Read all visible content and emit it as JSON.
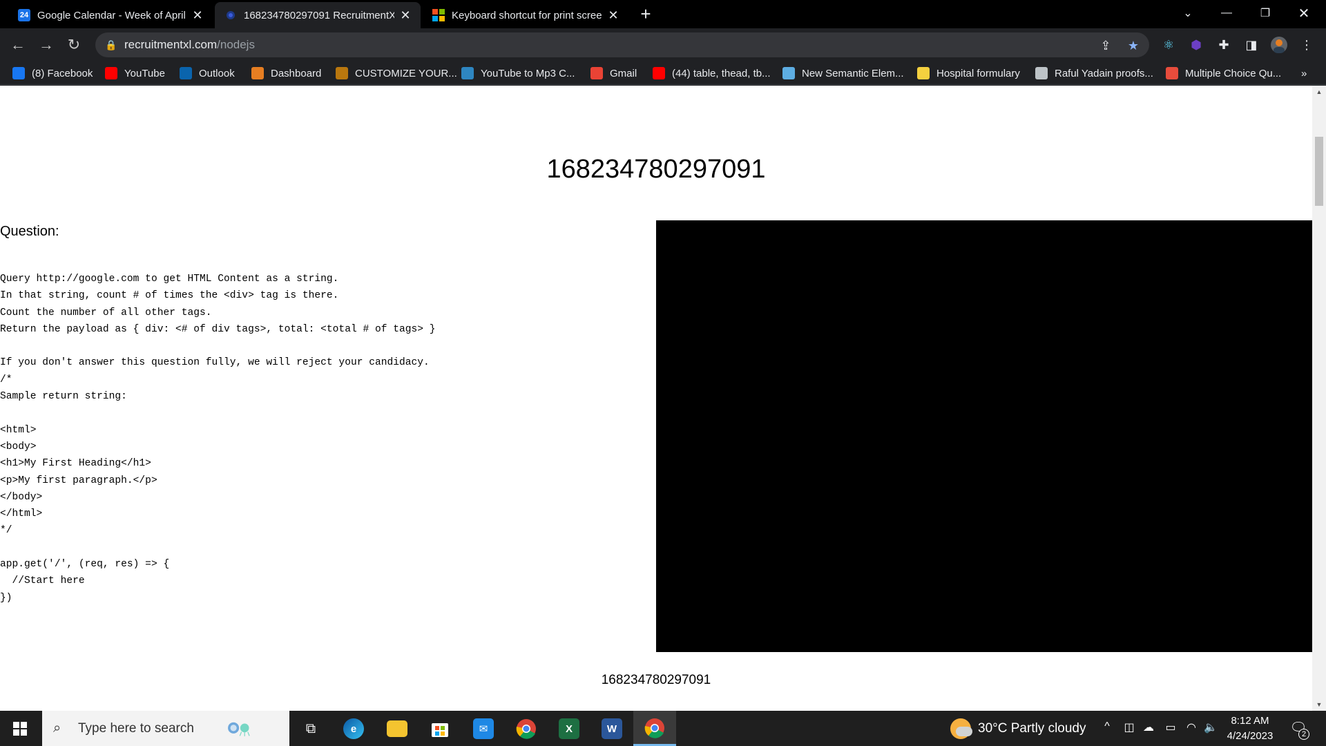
{
  "tabs": [
    {
      "title": "Google Calendar - Week of April",
      "favicon": "24",
      "active": false
    },
    {
      "title": "168234780297091 RecruitmentXL",
      "favicon": "",
      "active": true
    },
    {
      "title": "Keyboard shortcut for print scree",
      "favicon": "",
      "active": false
    }
  ],
  "address": {
    "host": "recruitmentxl.com",
    "path": "/nodejs"
  },
  "bookmarks": [
    {
      "label": "(8) Facebook",
      "icon": "facebook-icon",
      "color": "#1877f2"
    },
    {
      "label": "YouTube",
      "icon": "youtube-icon",
      "color": "#ff0000"
    },
    {
      "label": "Outlook",
      "icon": "outlook-icon",
      "color": "#0a64ad"
    },
    {
      "label": "Dashboard",
      "icon": "dashboard-icon",
      "color": "#e67e22"
    },
    {
      "label": "CUSTOMIZE YOUR...",
      "icon": "customize-icon",
      "color": "#b9770e"
    },
    {
      "label": "YouTube to Mp3 C...",
      "icon": "download-icon",
      "color": "#2e86c1"
    },
    {
      "label": "Gmail",
      "icon": "gmail-icon",
      "color": "#ea4335"
    },
    {
      "label": "(44) table, thead, tb...",
      "icon": "youtube-icon",
      "color": "#ff0000"
    },
    {
      "label": "New Semantic Elem...",
      "icon": "semantic-icon",
      "color": "#5dade2"
    },
    {
      "label": "Hospital formulary",
      "icon": "hospital-icon",
      "color": "#f4d03f"
    },
    {
      "label": "Raful Yadain proofs...",
      "icon": "document-icon",
      "color": "#bdc3c7"
    },
    {
      "label": "Multiple Choice Qu...",
      "icon": "e-icon",
      "color": "#e74c3c"
    }
  ],
  "bookmarks_overflow": "»",
  "page": {
    "heading": "168234780297091",
    "question_label": "Question:",
    "code": "Query http://google.com to get HTML Content as a string.\nIn that string, count # of times the <div> tag is there.\nCount the number of all other tags.\nReturn the payload as { div: <# of div tags>, total: <total # of tags> }\n\nIf you don't answer this question fully, we will reject your candidacy.\n/*\nSample return string:\n\n<html>\n<body>\n<h1>My First Heading</h1>\n<p>My first paragraph.</p>\n</body>\n</html>\n*/\n\napp.get('/', (req, res) => {\n  //Start here\n})",
    "footer_id": "168234780297091"
  },
  "taskbar": {
    "search_placeholder": "Type here to search",
    "weather": "30°C  Partly cloudy",
    "time": "8:12 AM",
    "date": "4/24/2023",
    "notifications": "2"
  },
  "colors": {
    "page_bg": "#ffffff",
    "chrome_bg": "#202124",
    "tabstrip_bg": "#000000",
    "video_bg": "#000000"
  }
}
